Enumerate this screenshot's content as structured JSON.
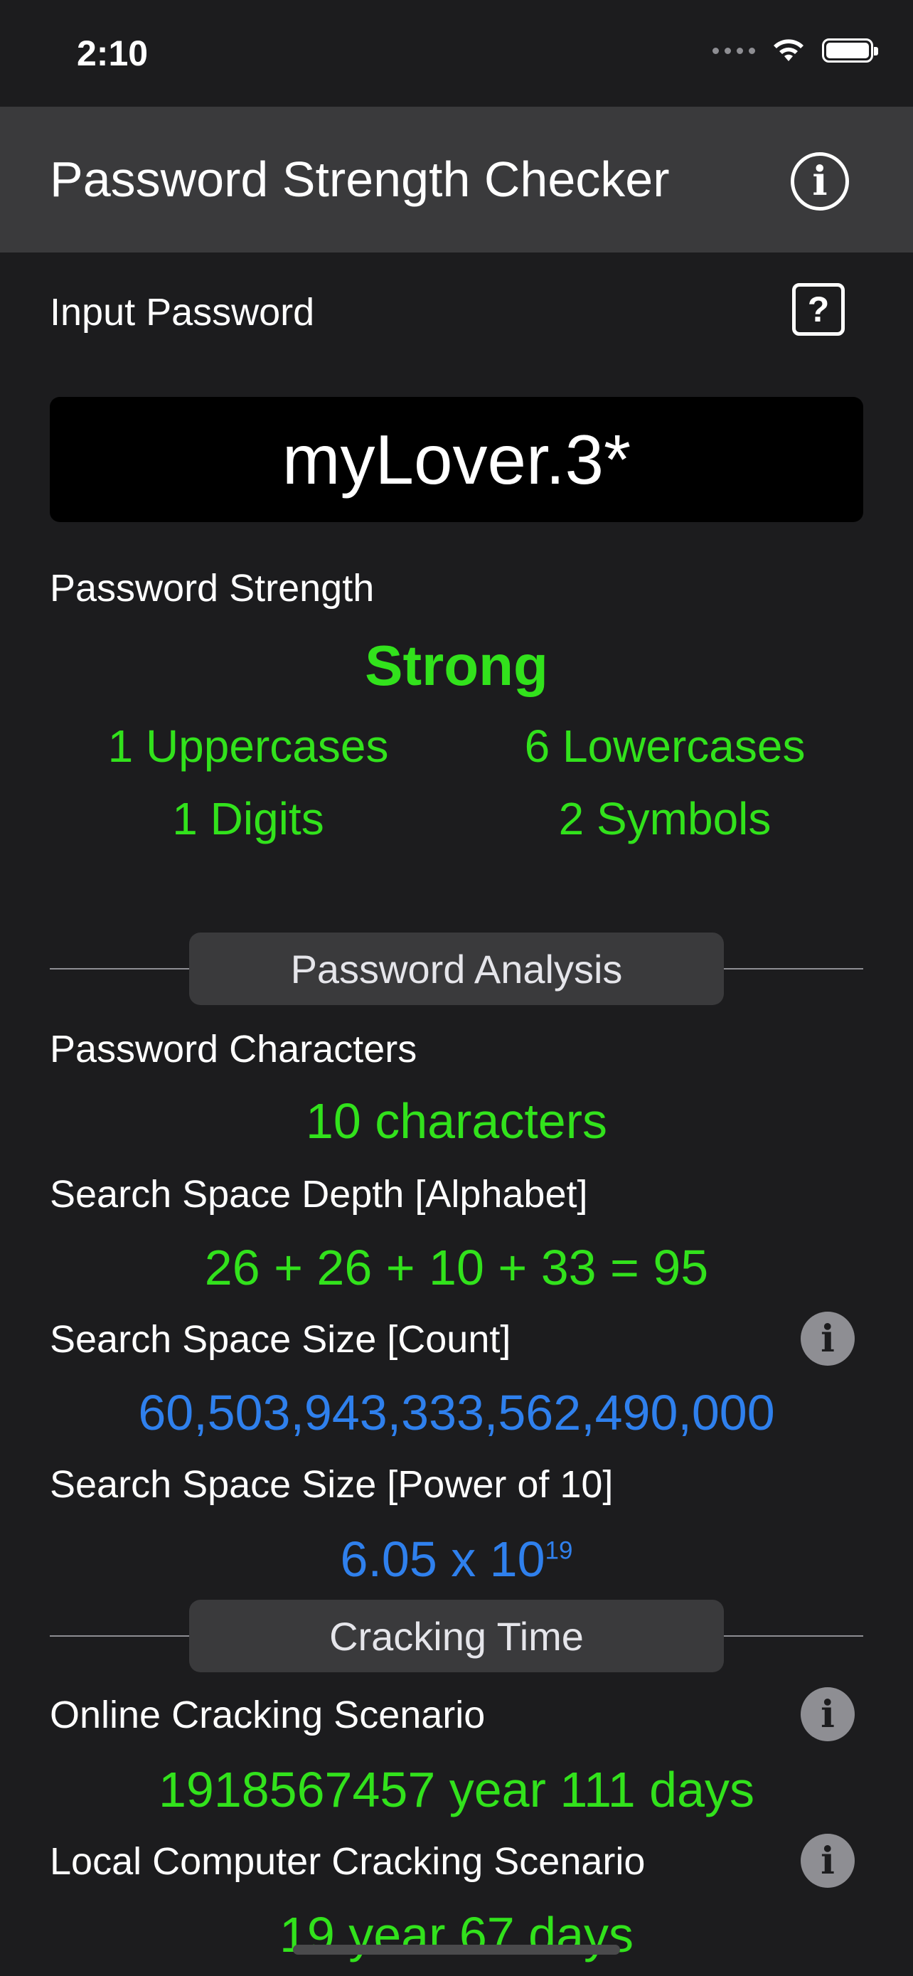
{
  "status_bar": {
    "time": "2:10"
  },
  "nav": {
    "title": "Password Strength Checker",
    "info_icon": "info-circle-icon"
  },
  "input": {
    "label": "Input Password",
    "help_glyph": "?",
    "password": "myLover.3*"
  },
  "strength": {
    "label": "Password Strength",
    "rating": "Strong",
    "uppercases": "1 Uppercases",
    "lowercases": "6 Lowercases",
    "digits": "1 Digits",
    "symbols": "2 Symbols"
  },
  "analysis": {
    "section_title": "Password Analysis",
    "characters_label": "Password Characters",
    "characters_value": "10 characters",
    "depth_label": "Search Space Depth [Alphabet]",
    "depth_value": "26 + 26 + 10 + 33 = 95",
    "count_label": "Search Space Size [Count]",
    "count_value": "60,503,943,333,562,490,000",
    "power_label": "Search Space Size [Power of 10]",
    "power_mantissa": "6.05 x 10",
    "power_exponent": "19"
  },
  "cracking": {
    "section_title": "Cracking Time",
    "online_label": "Online Cracking Scenario",
    "online_value": "1918567457 year 111 days",
    "local_label": "Local Computer Cracking Scenario",
    "local_value": "19 year 67 days"
  },
  "colors": {
    "green": "#32e21c",
    "blue": "#2f80ed",
    "background": "#1c1c1e"
  }
}
